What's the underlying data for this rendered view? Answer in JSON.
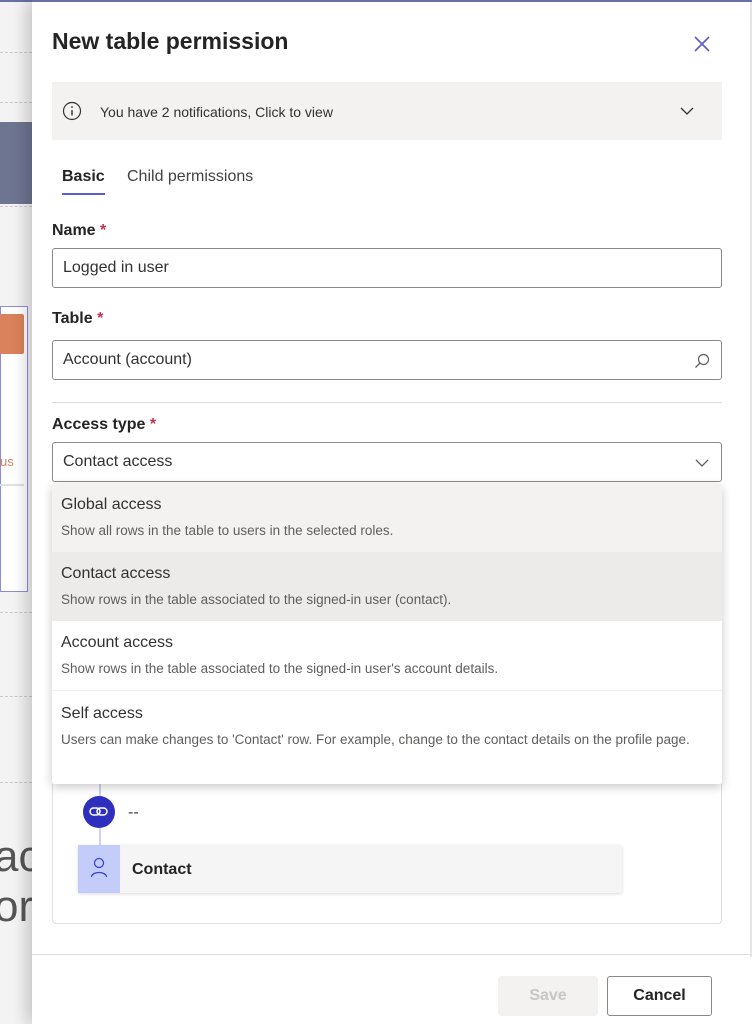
{
  "panel": {
    "title": "New table permission"
  },
  "notification": {
    "text": "You have 2 notifications, Click to view"
  },
  "tabs": [
    {
      "label": "Basic"
    },
    {
      "label": "Child permissions"
    }
  ],
  "fields": {
    "name": {
      "label": "Name",
      "required_mark": "*",
      "value": "Logged in user"
    },
    "table": {
      "label": "Table",
      "required_mark": "*",
      "value": "Account (account)"
    },
    "access_type": {
      "label": "Access type",
      "required_mark": "*",
      "value": "Contact access"
    }
  },
  "access_options": [
    {
      "title": "Global access",
      "description": "Show all rows in the table to users in the selected roles."
    },
    {
      "title": "Contact access",
      "description": "Show rows in the table associated to the signed-in user (contact)."
    },
    {
      "title": "Account access",
      "description": "Show rows in the table associated to the signed-in user's account details."
    },
    {
      "title": "Self access",
      "description": "Users can make changes to 'Contact' row. For example, change to the contact details on the profile page."
    }
  ],
  "relationship": {
    "link_text": "--",
    "node_label": "Contact"
  },
  "footer": {
    "save_label": "Save",
    "cancel_label": "Cancel"
  },
  "background_page": {
    "side_text": "us",
    "big_text": "ac\nor"
  },
  "colors": {
    "accent": "#5b5fc7",
    "required": "#c4314b",
    "link_node": "#2e2fbf",
    "contact_avatar": "#c4cdfa"
  }
}
